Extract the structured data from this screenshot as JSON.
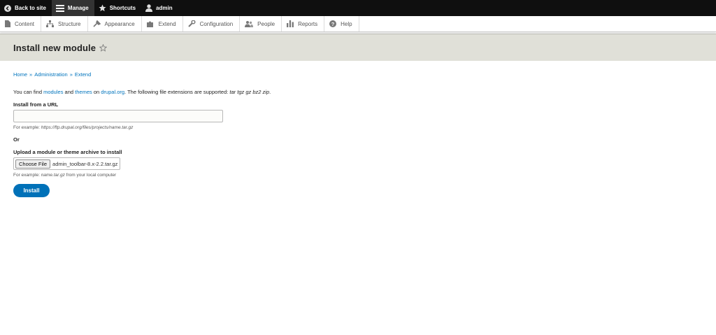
{
  "toolbar": {
    "back_to_site": "Back to site",
    "manage": "Manage",
    "shortcuts": "Shortcuts",
    "user": "admin"
  },
  "tray": {
    "items": [
      {
        "label": "Content",
        "icon": "content-icon"
      },
      {
        "label": "Structure",
        "icon": "structure-icon"
      },
      {
        "label": "Appearance",
        "icon": "appearance-icon"
      },
      {
        "label": "Extend",
        "icon": "extend-icon"
      },
      {
        "label": "Configuration",
        "icon": "configuration-icon"
      },
      {
        "label": "People",
        "icon": "people-icon"
      },
      {
        "label": "Reports",
        "icon": "reports-icon"
      },
      {
        "label": "Help",
        "icon": "help-icon"
      }
    ]
  },
  "page": {
    "title": "Install new module"
  },
  "breadcrumb": {
    "items": [
      "Home",
      "Administration",
      "Extend"
    ],
    "separator": "»"
  },
  "intro": {
    "prefix": "You can find ",
    "modules": "modules",
    "and": " and ",
    "themes": "themes",
    "on": " on ",
    "site": "drupal.org",
    "suffix": ". The following file extensions are supported: ",
    "extensions": "tar tgz gz bz2 zip",
    "end": "."
  },
  "url_field": {
    "label": "Install from a URL",
    "value": "",
    "hint_prefix": "For example: ",
    "hint_example": "https://ftp.drupal.org/files/projects/name.tar.gz"
  },
  "or_label": "Or",
  "upload_field": {
    "label": "Upload a module or theme archive to install",
    "button": "Choose File",
    "file_name": "admin_toolbar-8.x-2.2.tar.gz",
    "hint_prefix": "For example: ",
    "hint_example": "name.tar.gz",
    "hint_suffix": " from your local computer"
  },
  "submit": {
    "label": "Install"
  },
  "colors": {
    "link": "#0074bd",
    "primary_button": "#0071b8",
    "toolbar_bg": "#0f0f0f",
    "header_band": "#e0e0d8"
  }
}
